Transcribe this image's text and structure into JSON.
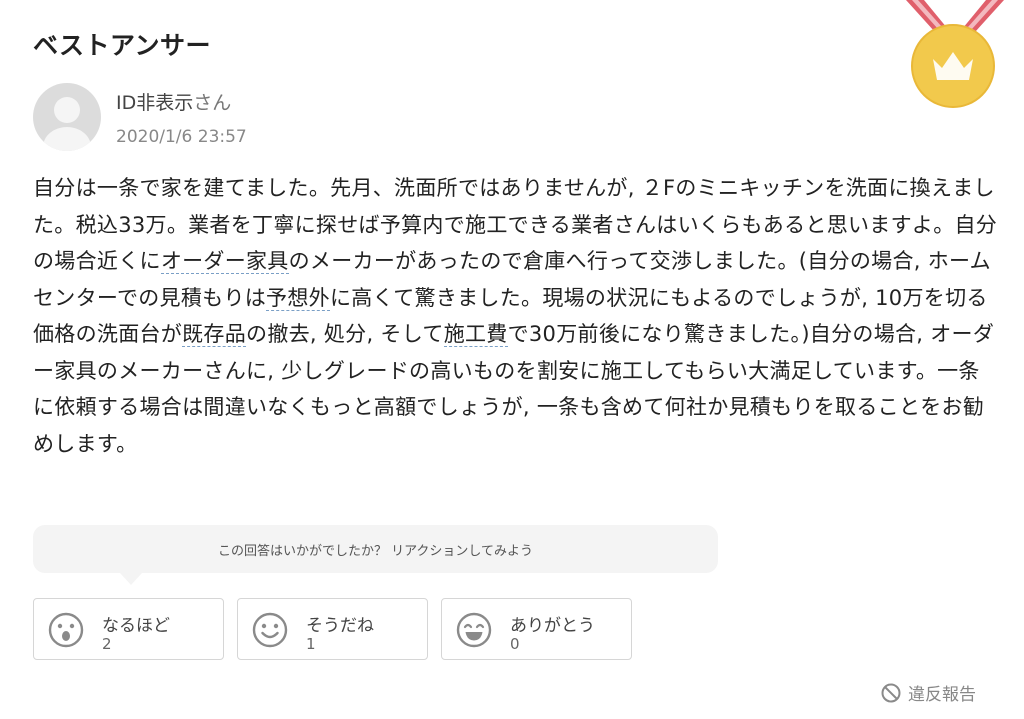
{
  "header": {
    "title": "ベストアンサー"
  },
  "medal": {
    "icon": "crown-medal-icon",
    "gold": "#f2c94c",
    "ribbon": "#e05f6b"
  },
  "author": {
    "name": "ID非表示",
    "suffix": "さん",
    "date": "2020/1/6 23:57"
  },
  "answer": {
    "segments": [
      "自分は一条で家を建てました。先月、洗面所ではありませんが, ２Fのミニキッチンを洗面に換えました。税込33万。業者を丁寧に探せば予算内で施工できる業者さんはいくらもあると思いますよ。自分の場合近くに",
      "オーダー家具",
      "のメーカーがあったので倉庫へ行って交渉しました。(自分の場合, ホームセンターでの見積もりは",
      "予想外",
      "に高くて驚きました。現場の状況にもよるのでしょうが, 10万を切る価格の洗面台が",
      "既存品",
      "の撤去, 処分, そして",
      "施工費",
      "で30万前後になり驚きました。)自分の場合, オーダー家具のメーカーさんに, 少しグレードの高いものを割安に施工してもらい大満足しています。一条に依頼する場合は間違いなくもっと高額でしょうが, 一条も含めて何社か見積もりを取ることをお勧めします。"
    ]
  },
  "reaction_prompt": "この回答はいかがでしたか？ リアクションしてみよう",
  "reactions": [
    {
      "label": "なるほど",
      "count": "2",
      "icon": "surprised-face-icon"
    },
    {
      "label": "そうだね",
      "count": "1",
      "icon": "smile-face-icon"
    },
    {
      "label": "ありがとう",
      "count": "0",
      "icon": "happy-face-icon"
    }
  ],
  "report": {
    "label": "違反報告",
    "icon": "prohibited-icon"
  }
}
